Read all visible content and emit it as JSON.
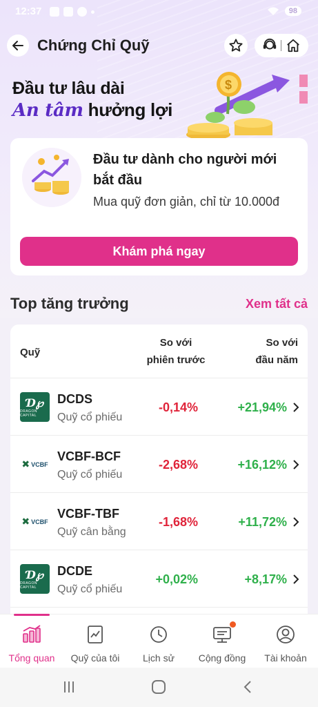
{
  "status_bar": {
    "time": "12:37",
    "battery": "98"
  },
  "header": {
    "title": "Chứng Chỉ Quỹ"
  },
  "banner": {
    "line1": "Đầu tư lâu dài",
    "line2_accent": "An tâm",
    "line2_rest": " hưởng lợi"
  },
  "promo": {
    "title": "Đầu tư dành cho người mới bắt đầu",
    "subtitle": "Mua quỹ đơn giản, chỉ từ 10.000đ",
    "button": "Khám phá ngay"
  },
  "section": {
    "title": "Top tăng trưởng",
    "see_all": "Xem tất cả"
  },
  "table": {
    "headers": {
      "fund": "Quỹ",
      "prev_line1": "So với",
      "prev_line2": "phiên trước",
      "year_line1": "So với",
      "year_line2": "đầu năm"
    },
    "rows": [
      {
        "code": "DCDS",
        "type": "Quỹ cổ phiếu",
        "prev": "-0,14%",
        "year": "+21,94%",
        "logo": "dragon-capital-logo"
      },
      {
        "code": "VCBF-BCF",
        "type": "Quỹ cổ phiếu",
        "prev": "-2,68%",
        "year": "+16,12%",
        "logo": "vcbf-logo"
      },
      {
        "code": "VCBF-TBF",
        "type": "Quỹ cân bằng",
        "prev": "-1,68%",
        "year": "+11,72%",
        "logo": "vcbf-logo"
      },
      {
        "code": "DCDE",
        "type": "Quỹ cổ phiếu",
        "prev": "+0,02%",
        "year": "+8,17%",
        "logo": "dragon-capital-logo"
      }
    ]
  },
  "logo_text": {
    "dragon": "DRAGON CAPITAL",
    "vcbf": "VCBF"
  },
  "nav": {
    "items": [
      {
        "label": "Tổng quan",
        "icon": "overview-icon"
      },
      {
        "label": "Quỹ của tôi",
        "icon": "my-fund-icon"
      },
      {
        "label": "Lịch sử",
        "icon": "history-icon"
      },
      {
        "label": "Cộng đồng",
        "icon": "community-icon"
      },
      {
        "label": "Tài khoản",
        "icon": "account-icon"
      }
    ]
  },
  "colors": {
    "accent": "#e0308a",
    "positive": "#2fb04b",
    "negative": "#e0243a",
    "brand_purple": "#5a2bc4"
  }
}
